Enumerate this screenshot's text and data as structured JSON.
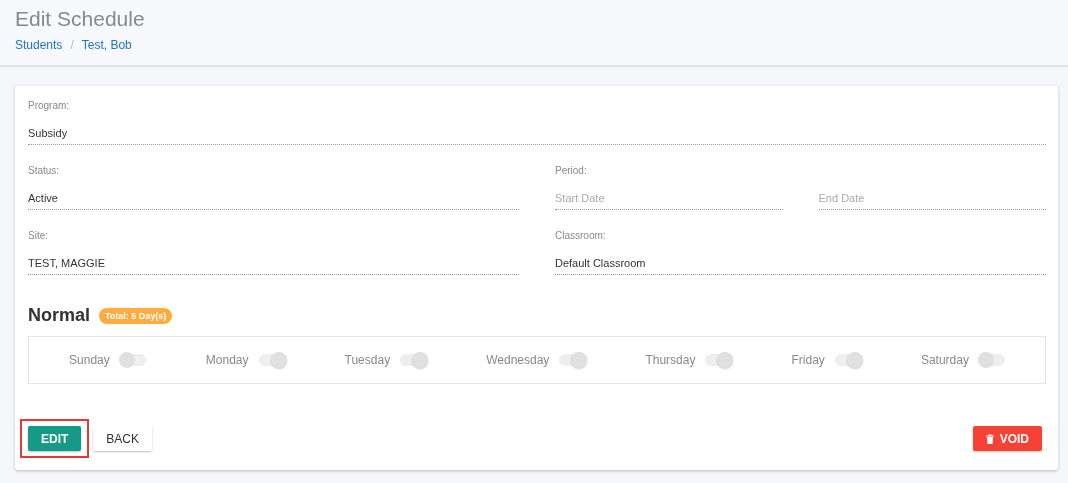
{
  "header": {
    "title": "Edit Schedule",
    "breadcrumbs": [
      {
        "label": "Students"
      },
      {
        "label": "Test, Bob"
      }
    ],
    "separator": "/"
  },
  "form": {
    "program": {
      "label": "Program:",
      "value": "Subsidy"
    },
    "status": {
      "label": "Status:",
      "value": "Active"
    },
    "period": {
      "label": "Period:",
      "start_placeholder": "Start Date",
      "end_placeholder": "End Date"
    },
    "site": {
      "label": "Site:",
      "value": "TEST, MAGGIE"
    },
    "classroom": {
      "label": "Classroom:",
      "value": "Default Classroom"
    }
  },
  "schedule": {
    "title": "Normal",
    "badge": "Total: 5 Day(s)",
    "days": [
      {
        "label": "Sunday",
        "on": false
      },
      {
        "label": "Monday",
        "on": true
      },
      {
        "label": "Tuesday",
        "on": true
      },
      {
        "label": "Wednesday",
        "on": true
      },
      {
        "label": "Thursday",
        "on": true
      },
      {
        "label": "Friday",
        "on": true
      },
      {
        "label": "Saturday",
        "on": false
      }
    ]
  },
  "buttons": [
    {
      "kind": "primary",
      "label": "EDIT",
      "highlighted": true
    },
    {
      "kind": "plain",
      "label": "BACK",
      "highlighted": false
    },
    {
      "kind": "danger",
      "label": "VOID",
      "highlighted": false
    }
  ]
}
